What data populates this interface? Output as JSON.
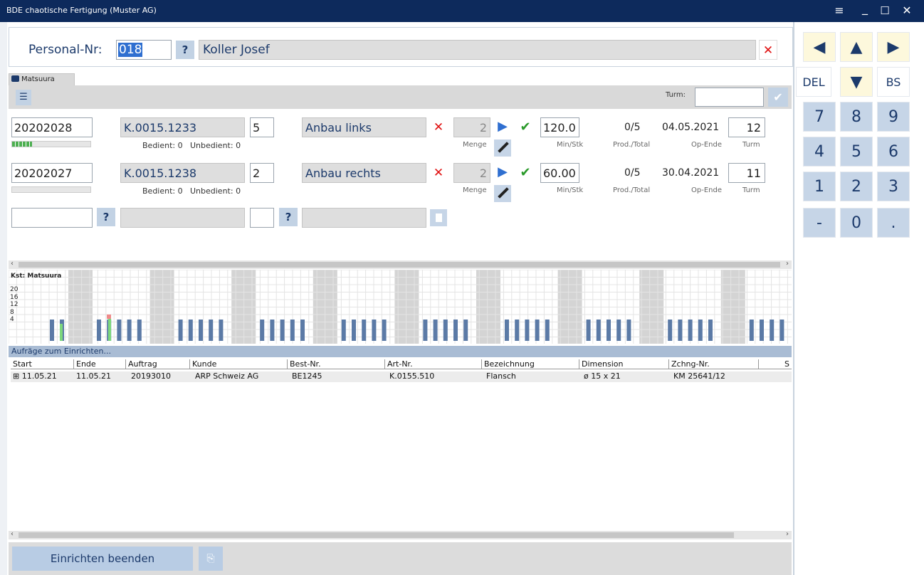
{
  "window": {
    "title": "BDE chaotische Fertigung (Muster AG)",
    "menu_glyph": "≡",
    "min_glyph": "_",
    "max_glyph": "☐",
    "close_glyph": "✕"
  },
  "personal": {
    "label": "Personal-Nr:",
    "number": "018",
    "q": "?",
    "name": "Koller Josef",
    "clear": "✕"
  },
  "tab": {
    "label": "Matsuura"
  },
  "toolbar": {
    "turm_label": "Turm:",
    "turm_value": ""
  },
  "orders": [
    {
      "auftrag": "20202028",
      "artikel": "K.0015.1233",
      "qty": "5",
      "op": "Anbau links",
      "menge": "2",
      "min": "120.0",
      "prod": "0/5",
      "date": "04.05.2021",
      "turm": "12",
      "bedient": "Bedient: 0",
      "unbedient": "Unbedient: 0",
      "menge_lbl": "Menge",
      "min_lbl": "Min/Stk",
      "prod_lbl": "Prod./Total",
      "opende_lbl": "Op-Ende",
      "turm_lbl": "Turm",
      "progress": 0.25
    },
    {
      "auftrag": "20202027",
      "artikel": "K.0015.1238",
      "qty": "2",
      "op": "Anbau rechts",
      "menge": "2",
      "min": "60.00",
      "prod": "0/5",
      "date": "30.04.2021",
      "turm": "11",
      "bedient": "Bedient: 0",
      "unbedient": "Unbedient: 0",
      "menge_lbl": "Menge",
      "min_lbl": "Min/Stk",
      "prod_lbl": "Prod./Total",
      "opende_lbl": "Op-Ende",
      "turm_lbl": "Turm",
      "progress": 0
    }
  ],
  "newrow": {
    "q1": "?",
    "q2": "?"
  },
  "chart": {
    "title": "Kst: Matsuura",
    "ticks": [
      "20",
      "16",
      "12",
      "8",
      "4"
    ]
  },
  "setup": {
    "title": "Aufräge zum Einrichten...",
    "columns": [
      "Start",
      "Ende",
      "Auftrag",
      "Kunde",
      "Best-Nr.",
      "Art-Nr.",
      "Bezeichnung",
      "Dimension",
      "Zchng-Nr.",
      "S"
    ],
    "rows": [
      [
        "⊞ 11.05.21",
        "11.05.21",
        "20193010",
        "ARP Schweiz AG",
        "BE1245",
        "K.0155.510",
        "Flansch",
        "ø 15 x 21",
        "KM 25641/12"
      ]
    ]
  },
  "footer": {
    "button": "Einrichten beenden"
  },
  "numpad": {
    "row1": [
      "◀",
      "▲",
      "▶"
    ],
    "row2": [
      "DEL",
      "▼",
      "BS"
    ],
    "row3": [
      "7",
      "8",
      "9"
    ],
    "row4": [
      "4",
      "5",
      "6"
    ],
    "row5": [
      "1",
      "2",
      "3"
    ],
    "row6": [
      "-",
      "0",
      "."
    ]
  }
}
